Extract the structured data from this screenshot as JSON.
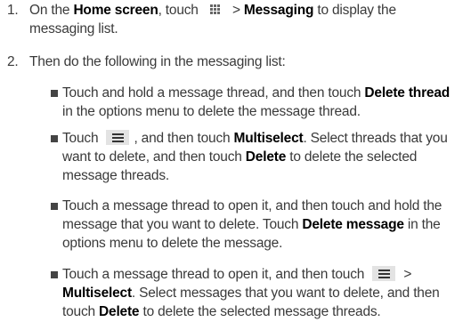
{
  "steps": [
    {
      "number": "1.",
      "parts": [
        "On the ",
        "Home screen",
        ", touch ",
        " > ",
        "Messaging",
        " to display the messaging list."
      ],
      "icon": "app-grid-icon"
    },
    {
      "number": "2.",
      "text": "Then do the following in the messaging list:"
    }
  ],
  "bullets": [
    {
      "parts": [
        "Touch and hold a message thread, and then touch ",
        "Delete thread",
        " in the options menu to delete the message thread."
      ]
    },
    {
      "parts": [
        "Touch ",
        ", and then touch ",
        "Multiselect",
        ". Select threads that you want to delete, and then touch ",
        "Delete",
        " to delete the selected message threads."
      ],
      "icon": "menu-icon"
    },
    {
      "parts": [
        "Touch a message thread to open it, and then touch and hold the message that you want to delete. Touch ",
        "Delete message",
        " in the options menu to delete the message."
      ]
    },
    {
      "parts": [
        "Touch a message thread to open it, and then touch ",
        " > ",
        "Multiselect",
        ". Select messages that you want to delete, and then touch ",
        "Delete",
        " to delete the selected message threads."
      ],
      "icon": "menu-icon"
    }
  ]
}
